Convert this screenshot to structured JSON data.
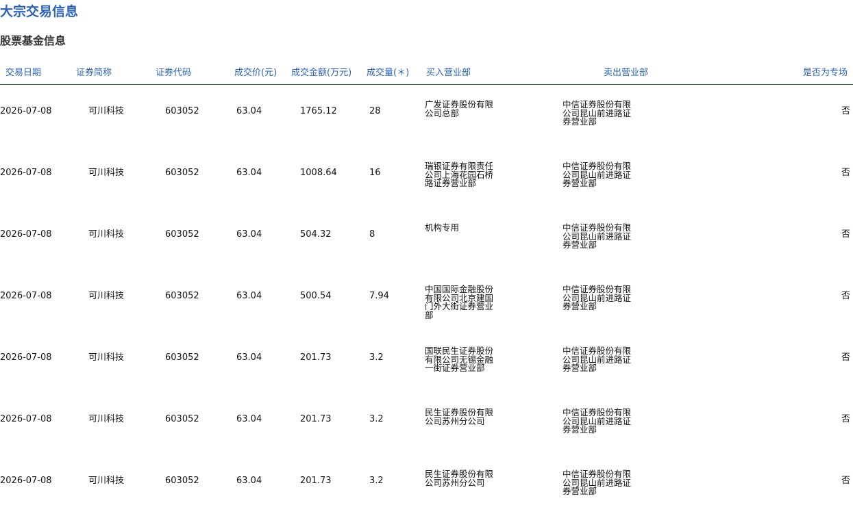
{
  "page": {
    "title": "大宗交易信息",
    "section_title": "股票基金信息"
  },
  "table": {
    "headers": {
      "date": "交易日期",
      "name": "证券简称",
      "code": "证券代码",
      "price": "成交价(元)",
      "amount": "成交金额(万元)",
      "volume": "成交量(＊)",
      "buy": "买入营业部",
      "sell": "卖出营业部",
      "special": "是否为专场"
    },
    "rows": [
      {
        "date": "2026-07-08",
        "name": "可川科技",
        "code": "603052",
        "price": "63.04",
        "amount": "1765.12",
        "volume": "28",
        "buy": "广发证券股份有限公司总部",
        "sell": "中信证券股份有限公司昆山前进路证券营业部",
        "special": "否"
      },
      {
        "date": "2026-07-08",
        "name": "可川科技",
        "code": "603052",
        "price": "63.04",
        "amount": "1008.64",
        "volume": "16",
        "buy": "瑞银证券有限责任公司上海花园石桥路证券营业部",
        "sell": "中信证券股份有限公司昆山前进路证券营业部",
        "special": "否"
      },
      {
        "date": "2026-07-08",
        "name": "可川科技",
        "code": "603052",
        "price": "63.04",
        "amount": "504.32",
        "volume": "8",
        "buy": "机构专用",
        "sell": "中信证券股份有限公司昆山前进路证券营业部",
        "special": "否"
      },
      {
        "date": "2026-07-08",
        "name": "可川科技",
        "code": "603052",
        "price": "63.04",
        "amount": "500.54",
        "volume": "7.94",
        "buy": "中国国际金融股份有限公司北京建国门外大街证券营业部",
        "sell": "中信证券股份有限公司昆山前进路证券营业部",
        "special": "否"
      },
      {
        "date": "2026-07-08",
        "name": "可川科技",
        "code": "603052",
        "price": "63.04",
        "amount": "201.73",
        "volume": "3.2",
        "buy": "国联民生证券股份有限公司无锡金融一街证券营业部",
        "sell": "中信证券股份有限公司昆山前进路证券营业部",
        "special": "否"
      },
      {
        "date": "2026-07-08",
        "name": "可川科技",
        "code": "603052",
        "price": "63.04",
        "amount": "201.73",
        "volume": "3.2",
        "buy": "民生证券股份有限公司苏州分公司",
        "sell": "中信证券股份有限公司昆山前进路证券营业部",
        "special": "否"
      },
      {
        "date": "2026-07-08",
        "name": "可川科技",
        "code": "603052",
        "price": "63.04",
        "amount": "201.73",
        "volume": "3.2",
        "buy": "民生证券股份有限公司苏州分公司",
        "sell": "中信证券股份有限公司昆山前进路证券营业部",
        "special": "否"
      }
    ]
  }
}
